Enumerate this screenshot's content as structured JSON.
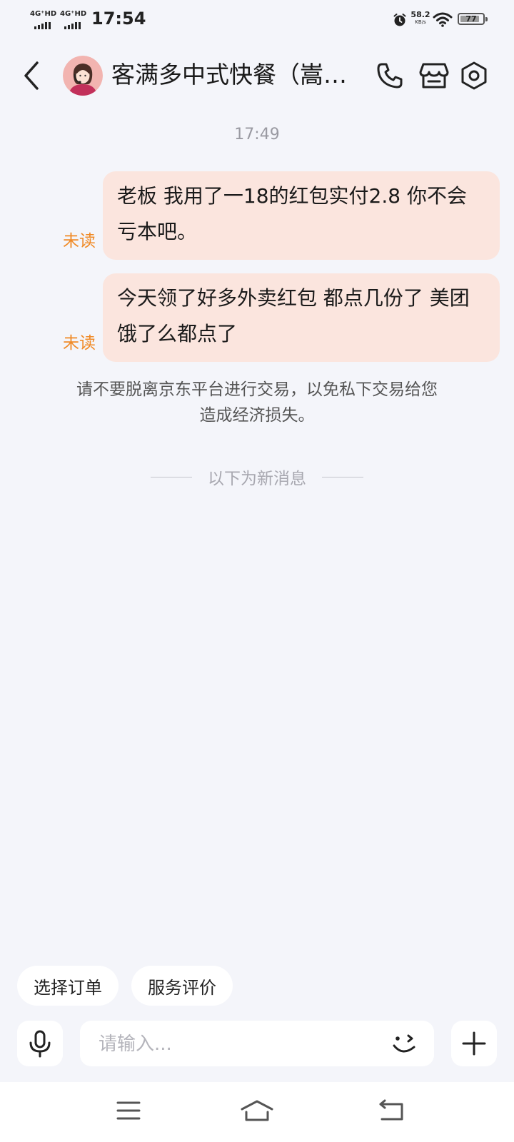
{
  "status_bar": {
    "signal_1": "4G⁺HD",
    "signal_2": "4G⁺HD",
    "time": "17:54",
    "net_speed_value": "58.2",
    "net_speed_unit": "KB/s",
    "battery_level": "77",
    "icons": [
      "signal-icon",
      "alarm-icon",
      "wifi-icon",
      "battery-icon"
    ]
  },
  "header": {
    "shop_name": "客满多中式快餐（嵩山...",
    "icons": [
      "back-chevron-icon",
      "avatar",
      "phone-icon",
      "store-icon",
      "settings-icon"
    ]
  },
  "chat": {
    "timestamp": "17:49",
    "messages": [
      {
        "text": "老板 我用了一18的红包实付2.8 你不会亏本吧。",
        "status": "未读"
      },
      {
        "text": "今天领了好多外卖红包 都点几份了 美团饿了么都点了",
        "status": "未读"
      }
    ],
    "notice": "请不要脱离京东平台进行交易，以免私下交易给您造成经济损失。",
    "divider_label": "以下为新消息"
  },
  "quick_actions": [
    "选择订单",
    "服务评价"
  ],
  "composer": {
    "placeholder": "请输入...",
    "icons": [
      "mic-icon",
      "emoji-icon",
      "plus-icon"
    ]
  },
  "nav_bar": {
    "icons": [
      "menu-icon",
      "home-icon",
      "back-icon"
    ]
  },
  "colors": {
    "background": "#f4f5fa",
    "bubble": "#fbe5de",
    "unread": "#f08a26",
    "text": "#1a1a1a"
  }
}
